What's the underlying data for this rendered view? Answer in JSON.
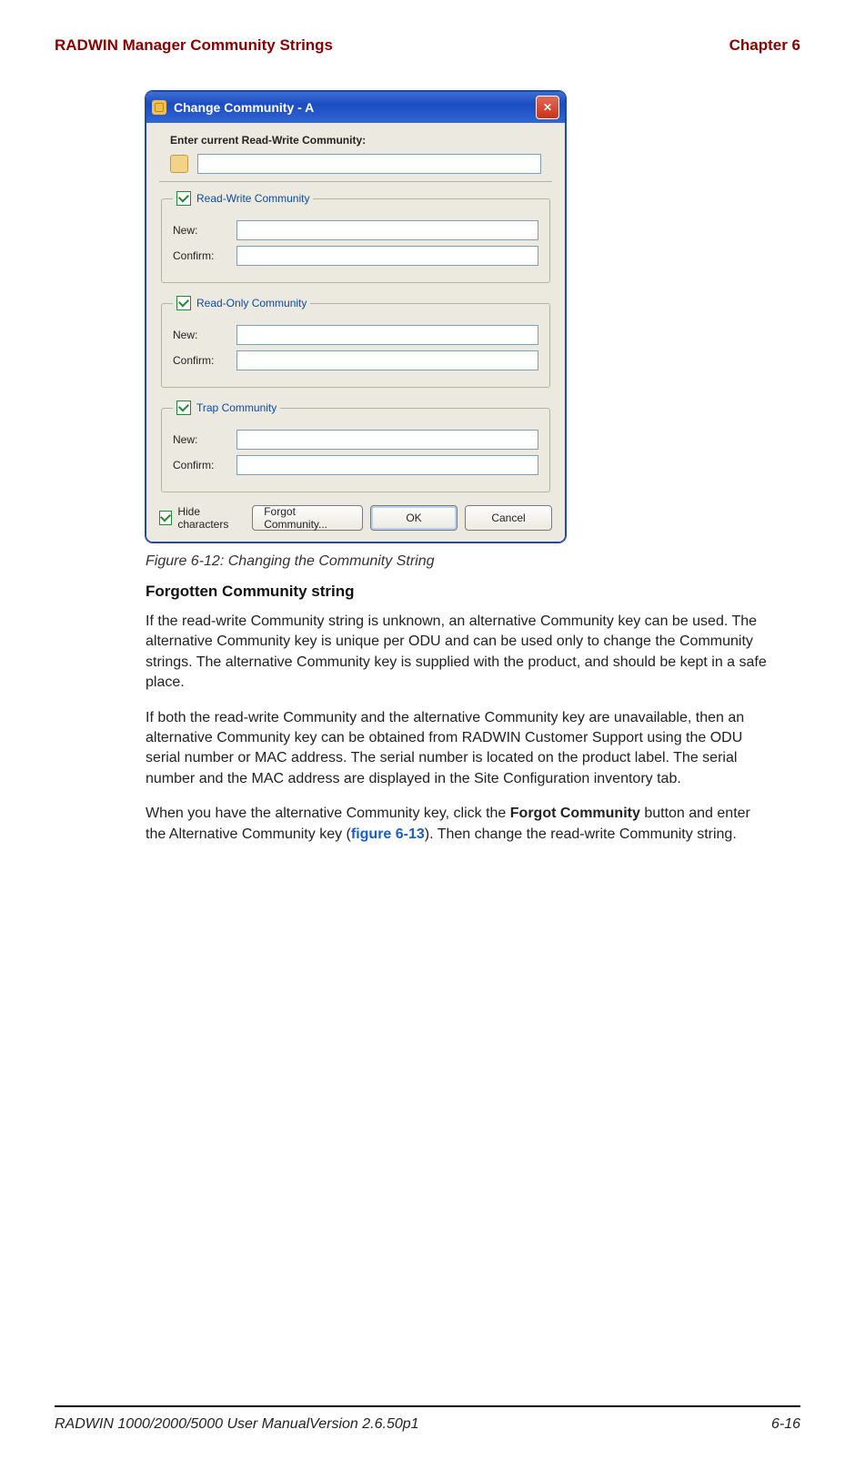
{
  "header": {
    "left": "RADWIN Manager Community Strings",
    "right": "Chapter 6"
  },
  "dialog": {
    "title": "Change Community - A",
    "prompt": "Enter current Read-Write Community:",
    "groups": {
      "rw": {
        "legend": "Read-Write Community",
        "new": "New:",
        "confirm": "Confirm:"
      },
      "ro": {
        "legend": "Read-Only Community",
        "new": "New:",
        "confirm": "Confirm:"
      },
      "trap": {
        "legend": "Trap Community",
        "new": "New:",
        "confirm": "Confirm:"
      }
    },
    "hide": "Hide characters",
    "forgot": "Forgot Community...",
    "ok": "OK",
    "cancel": "Cancel"
  },
  "fig_caption": "Figure 6-12: Changing the Community String",
  "subhead": "Forgotten Community string",
  "para1": "If the read-write Community string is unknown, an alternative Community key can be used. The alternative Community key is unique per ODU and can be used only to change the Community strings. The alternative Community key is supplied with the product, and should be kept in a safe place.",
  "para2": "If both the read-write Community and the alternative Community key are unavailable, then an alternative Community key can be obtained from RADWIN Customer Support using the ODU serial number or MAC address. The serial number is located on the product label. The serial number and the MAC address are displayed in the Site Configuration inventory tab.",
  "para3_prefix": "When you have the alternative Community key, click the ",
  "para3_bold": "Forgot Community",
  "para3_mid": " button and enter the Alternative Community key (",
  "para3_link": "figure 6-13",
  "para3_suffix": "). Then change the read-write Community string.",
  "footer": {
    "left": "RADWIN 1000/2000/5000 User ManualVersion  2.6.50p1",
    "right": "6-16"
  }
}
